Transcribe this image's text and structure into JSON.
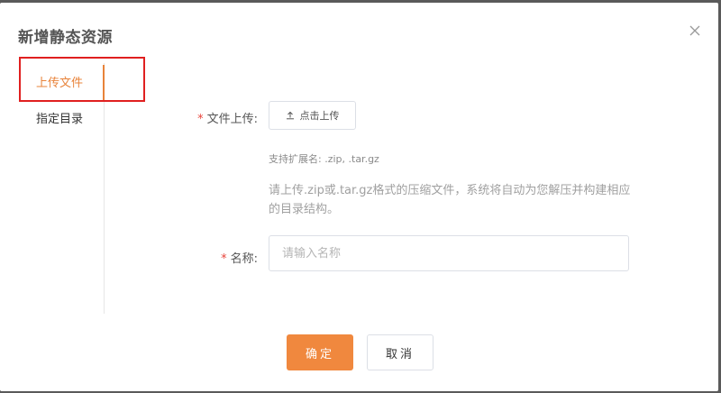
{
  "dialog": {
    "title": "新增静态资源",
    "close_icon": "close-icon"
  },
  "tabs": [
    {
      "label": "上传文件",
      "active": true
    },
    {
      "label": "指定目录",
      "active": false
    }
  ],
  "form": {
    "file_upload": {
      "label": "文件上传:",
      "required_mark": "*",
      "button_label": "点击上传",
      "button_icon": "upload-icon",
      "ext_hint": "支持扩展名: .zip, .tar.gz",
      "description": "请上传.zip或.tar.gz格式的压缩文件，系统将自动为您解压并构建相应的目录结构。"
    },
    "name": {
      "label": "名称:",
      "required_mark": "*",
      "placeholder": "请输入名称",
      "value": ""
    }
  },
  "footer": {
    "confirm_label": "确定",
    "cancel_label": "取消"
  },
  "colors": {
    "accent": "#f0883e",
    "highlight": "#e02020",
    "required": "#e8453c"
  }
}
